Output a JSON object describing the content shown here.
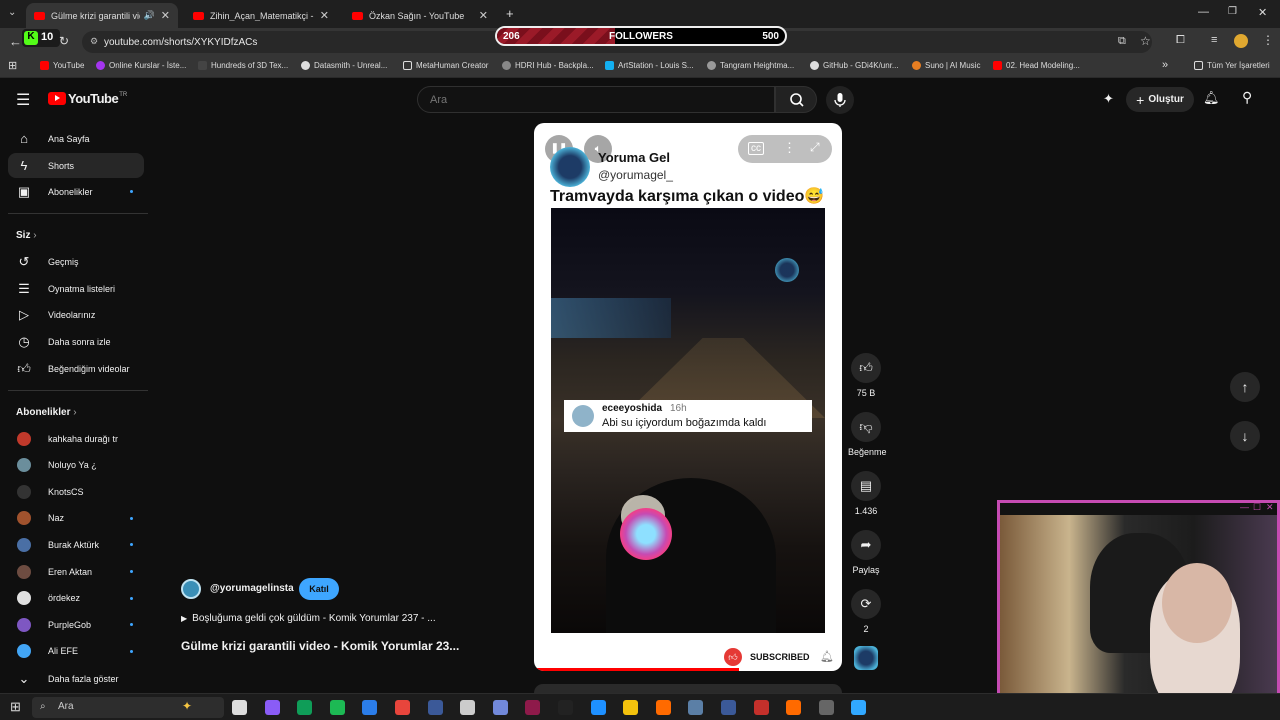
{
  "browser": {
    "tabs": [
      {
        "title": "Gülme krizi garantili video",
        "active": true
      },
      {
        "title": "Zihin_Açan_Matematikçi - YouT",
        "active": false
      },
      {
        "title": "Özkan Sağın - YouTube",
        "active": false
      }
    ],
    "new_tab": "+",
    "url": "youtube.com/shorts/XYKYIDfzACs",
    "bookmarks": [
      "YouTube",
      "Online Kurslar - İste...",
      "Hundreds of 3D Tex...",
      "Datasmith - Unreal...",
      "MetaHuman Creator",
      "HDRI Hub - Backpla...",
      "ArtStation - Louis S...",
      "Tangram Heightma...",
      "GitHub - GDi4K/unr...",
      "Suno | AI Music",
      "02. Head Modeling..."
    ],
    "all_bookmarks": "Tüm Yer İşaretleri",
    "kick_badge": "10"
  },
  "followers": {
    "current": "206",
    "label": "FOLLOWERS",
    "goal": "500",
    "progress": 0.41
  },
  "youtube": {
    "logo": "YouTube",
    "country": "TR",
    "search_placeholder": "Ara",
    "create_label": "Oluştur",
    "sidebar": {
      "main": [
        {
          "label": "Ana Sayfa",
          "icon": "home-icon"
        },
        {
          "label": "Shorts",
          "icon": "shorts-icon",
          "selected": true
        },
        {
          "label": "Abonelikler",
          "icon": "subscriptions-icon",
          "dot": true
        }
      ],
      "you_header": "Siz",
      "you": [
        {
          "label": "Geçmiş",
          "icon": "history-icon"
        },
        {
          "label": "Oynatma listeleri",
          "icon": "playlist-icon"
        },
        {
          "label": "Videolarınız",
          "icon": "your-videos-icon"
        },
        {
          "label": "Daha sonra izle",
          "icon": "watch-later-icon"
        },
        {
          "label": "Beğendiğim videolar",
          "icon": "liked-icon"
        }
      ],
      "subs_header": "Abonelikler",
      "subs": [
        {
          "label": "kahkaha durağı tr",
          "color": "#c0392b",
          "dot": false
        },
        {
          "label": "Noluyo Ya ¿",
          "color": "#6b8e9c",
          "dot": false
        },
        {
          "label": "KnotsCS",
          "color": "#333333",
          "dot": false
        },
        {
          "label": "Naz",
          "color": "#a0522d",
          "dot": true
        },
        {
          "label": "Burak Aktürk",
          "color": "#4a6fa5",
          "dot": true
        },
        {
          "label": "Eren Aktan",
          "color": "#6d4c41",
          "dot": true
        },
        {
          "label": "ördekez",
          "color": "#e0e0e0",
          "dot": true
        },
        {
          "label": "PurpleGob",
          "color": "#7e57c2",
          "dot": true
        },
        {
          "label": "Ali EFE",
          "color": "#42a5f5",
          "dot": true
        }
      ],
      "show_more": "Daha fazla göster"
    },
    "short": {
      "channel_name": "Yoruma Gel",
      "channel_handle": "@yorumagel_",
      "caption": "Tramvayda karşıma çıkan o video😅",
      "comment_user": "eceeyoshida",
      "comment_time": "16h",
      "comment_text": "Abi su içiyordum boğazımda kaldı",
      "subscribed_label": "SUBSCRIBED",
      "page_handle": "@yorumagelinsta",
      "join_label": "Katıl",
      "playlist_line": "Boşluğuma geldi çok güldüm - Komik Yorumlar 237 - ...",
      "title": "Gülme krizi garantili video - Komik Yorumlar 23..."
    },
    "actions": {
      "likes": "75 B",
      "dislike": "Beğenme",
      "comments": "1.436",
      "share": "Paylaş",
      "remix": "2"
    }
  },
  "taskbar": {
    "search": "Ara"
  }
}
